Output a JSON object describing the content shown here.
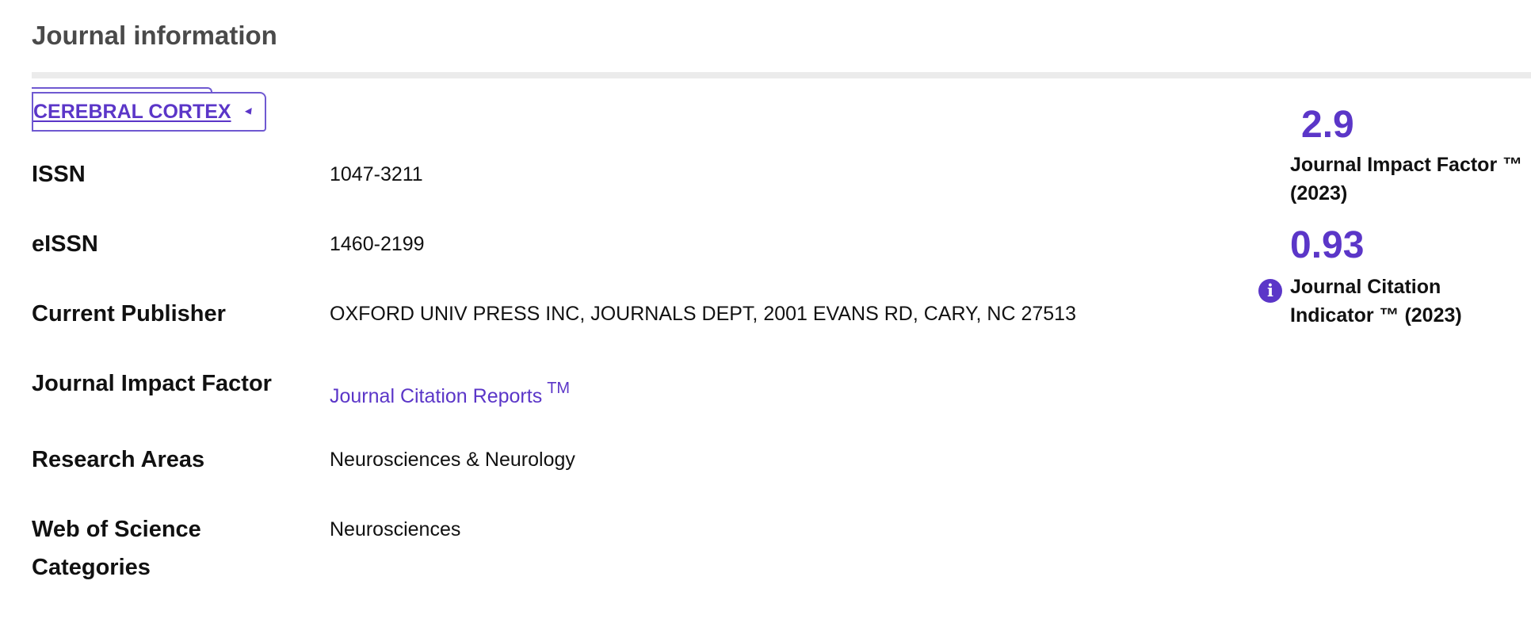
{
  "section": {
    "title": "Journal information"
  },
  "journal": {
    "name": "CEREBRAL CORTEX",
    "dropdown_icon": "caret-down-icon"
  },
  "rows": [
    {
      "label": "ISSN",
      "value": "1047-3211"
    },
    {
      "label": "eISSN",
      "value": "1460-2199"
    },
    {
      "label": "Current Publisher",
      "value": "OXFORD UNIV PRESS INC, JOURNALS DEPT, 2001 EVANS RD, CARY, NC 27513"
    },
    {
      "label": "Journal Impact Factor",
      "value": "Journal Citation Reports",
      "value_suffix": "TM"
    },
    {
      "label": "Research Areas",
      "value": "Neurosciences & Neurology"
    },
    {
      "label": "Web of Science Categories",
      "value": "Neurosciences"
    }
  ],
  "metrics": {
    "impact_factor": {
      "value": "2.9",
      "label": "Journal Impact Factor ™ (2023)"
    },
    "citation_indicator": {
      "value": "0.93",
      "label": "Journal Citation Indicator ™ (2023)",
      "icon": "info-icon",
      "icon_glyph": "i"
    }
  },
  "colors": {
    "accent": "#5b36c8",
    "divider": "#ebebeb",
    "heading": "#4a4a4a"
  }
}
